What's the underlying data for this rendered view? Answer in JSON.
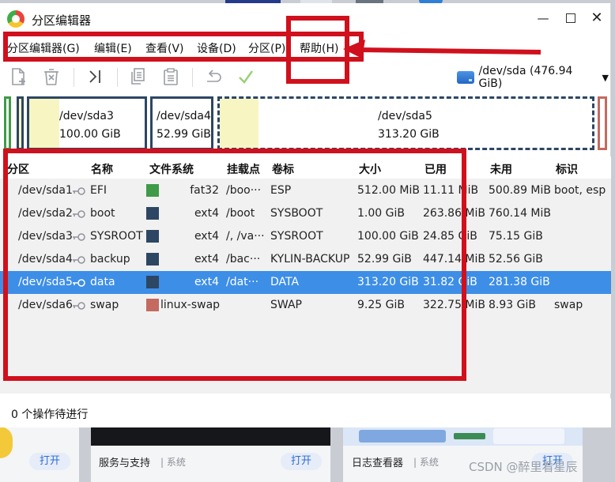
{
  "window": {
    "title": "分区编辑器",
    "minimize_glyph": "—",
    "close_glyph": "✕"
  },
  "menu": [
    {
      "label": "分区编辑器(G)"
    },
    {
      "label": "编辑(E)"
    },
    {
      "label": "查看(V)"
    },
    {
      "label": "设备(D)"
    },
    {
      "label": "分区(P)"
    },
    {
      "label": "帮助(H)"
    }
  ],
  "toolbar": {
    "buttons": [
      "new-partition-icon",
      "delete-partition-icon",
      "resize-move-icon",
      "copy-icon",
      "paste-icon",
      "undo-icon",
      "apply-icon"
    ],
    "device": "/dev/sda (476.94 GiB)"
  },
  "partition_map": [
    {
      "name": "/dev/sda3",
      "size": "100.00 GiB"
    },
    {
      "name": "/dev/sda4",
      "size": "52.99 GiB"
    },
    {
      "name": "/dev/sda5",
      "size": "313.20 GiB"
    }
  ],
  "table": {
    "columns": [
      "分区",
      "名称",
      "文件系统",
      "挂载点",
      "卷标",
      "大小",
      "已用",
      "未用",
      "标识"
    ],
    "rows": [
      {
        "partition": "/dev/sda1",
        "name": "EFI",
        "fs": "fat32",
        "fs_color": "#3f9b47",
        "mount": "/boo···",
        "label": "ESP",
        "size": "512.00 MiB",
        "used": "11.11 MiB",
        "unused": "500.89 MiB",
        "flags": "boot, esp"
      },
      {
        "partition": "/dev/sda2",
        "name": "boot",
        "fs": "ext4",
        "fs_color": "#2d4663",
        "mount": "/boot",
        "label": "SYSBOOT",
        "size": "1.00 GiB",
        "used": "263.86 MiB",
        "unused": "760.14 MiB",
        "flags": ""
      },
      {
        "partition": "/dev/sda3",
        "name": "SYSROOT",
        "fs": "ext4",
        "fs_color": "#2d4663",
        "mount": "/, /va···",
        "label": "SYSROOT",
        "size": "100.00 GiB",
        "used": "24.85 GiB",
        "unused": "75.15 GiB",
        "flags": ""
      },
      {
        "partition": "/dev/sda4",
        "name": "backup",
        "fs": "ext4",
        "fs_color": "#2d4663",
        "mount": "/bac···",
        "label": "KYLIN-BACKUP",
        "size": "52.99 GiB",
        "used": "447.14 MiB",
        "unused": "52.56 GiB",
        "flags": ""
      },
      {
        "partition": "/dev/sda5",
        "name": "data",
        "fs": "ext4",
        "fs_color": "#2d4663",
        "mount": "/dat···",
        "label": "DATA",
        "size": "313.20 GiB",
        "used": "31.82 GiB",
        "unused": "281.38 GiB",
        "flags": ""
      },
      {
        "partition": "/dev/sda6",
        "name": "swap",
        "fs": "linux-swap",
        "fs_color": "#c46a60",
        "mount": "",
        "label": "SWAP",
        "size": "9.25 GiB",
        "used": "322.75 MiB",
        "unused": "8.93 GiB",
        "flags": "swap"
      }
    ],
    "selected_index": 4
  },
  "status": "0 个操作待进行",
  "background": {
    "cards": [
      {
        "open": "打开"
      },
      {
        "title": "服务与支持",
        "category": "系统",
        "open": "打开"
      },
      {
        "title": "日志查看器",
        "category": "系统",
        "open": "打开"
      }
    ],
    "watermark": "CSDN @醉里看星辰"
  }
}
